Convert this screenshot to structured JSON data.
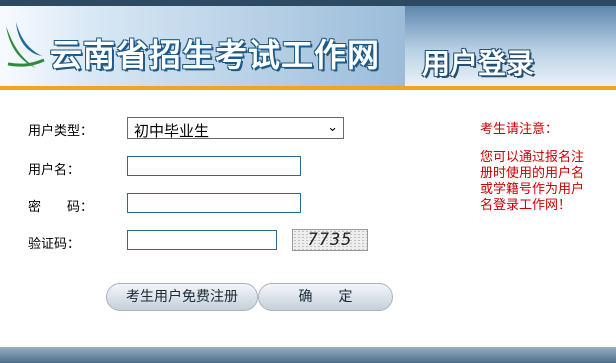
{
  "header": {
    "site_title": "云南省招生考试工作网",
    "page_title": "用户登录"
  },
  "form": {
    "user_type_label": "用户类型：",
    "user_type_selected": "初中毕业生",
    "username_label": "用户名：",
    "username_value": "",
    "password_label": "密　　码：",
    "password_value": "",
    "captcha_label": "验证码：",
    "captcha_value": "",
    "captcha_text": "7735"
  },
  "notice": {
    "title": "考生请注意：",
    "body": "您可以通过报名注册时使用的用户名或学籍号作为用户名登录工作网！"
  },
  "buttons": {
    "register": "考生用户免费注册",
    "confirm": "确定"
  },
  "colors": {
    "notice": "#cc0000",
    "accent_bar": "#f3a41f",
    "banner": "#5f87ad"
  }
}
